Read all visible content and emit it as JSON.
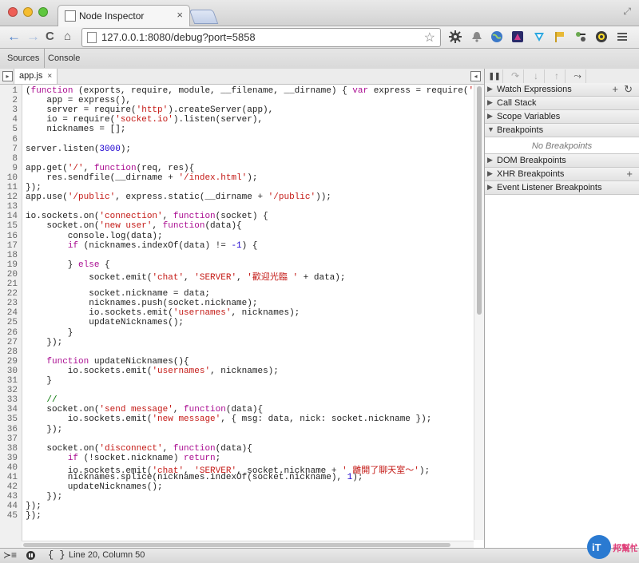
{
  "browser": {
    "tab_title": "Node Inspector",
    "tab_close": "×",
    "url": "127.0.0.1:8080/debug?port=5858",
    "nav": {
      "back": "←",
      "forward": "→",
      "reload": "C",
      "home": "⌂",
      "star": "☆"
    }
  },
  "devtools": {
    "tabs": {
      "sources": "Sources",
      "console": "Console"
    },
    "file_tab": "app.js",
    "file_tab_close": "×",
    "code_lines": [
      "(function (exports, require, module, __filename, __dirname) { var express = require('express'),",
      "    app = express(),",
      "    server = require('http').createServer(app),",
      "    io = require('socket.io').listen(server),",
      "    nicknames = [];",
      "",
      "server.listen(3000);",
      "",
      "app.get('/', function(req, res){",
      "    res.sendfile(__dirname + '/index.html');",
      "});",
      "app.use('/public', express.static(__dirname + '/public'));",
      "",
      "io.sockets.on('connection', function(socket) {",
      "    socket.on('new user', function(data){",
      "        console.log(data);",
      "        if (nicknames.indexOf(data) != -1) {",
      "",
      "        } else {",
      "            socket.emit('chat', 'SERVER', '歡迎光臨 ' + data);",
      "",
      "            socket.nickname = data;",
      "            nicknames.push(socket.nickname);",
      "            io.sockets.emit('usernames', nicknames);",
      "            updateNicknames();",
      "        }",
      "    });",
      "",
      "    function updateNicknames(){",
      "        io.sockets.emit('usernames', nicknames);",
      "    }",
      "",
      "    //",
      "    socket.on('send message', function(data){",
      "        io.sockets.emit('new message', { msg: data, nick: socket.nickname });",
      "    });",
      "",
      "    socket.on('disconnect', function(data){",
      "        if (!socket.nickname) return;",
      "        io.sockets.emit('chat', 'SERVER', socket.nickname + ' 離開了聊天室～');",
      "        nicknames.splice(nicknames.indexOf(socket.nickname), 1);",
      "        updateNicknames();",
      "    });",
      "});",
      "});"
    ],
    "sidebar": {
      "panes": [
        {
          "label": "Watch Expressions",
          "expanded": false
        },
        {
          "label": "Call Stack",
          "expanded": false
        },
        {
          "label": "Scope Variables",
          "expanded": false
        },
        {
          "label": "Breakpoints",
          "expanded": true
        },
        {
          "label": "DOM Breakpoints",
          "expanded": false
        },
        {
          "label": "XHR Breakpoints",
          "expanded": false
        },
        {
          "label": "Event Listener Breakpoints",
          "expanded": false
        }
      ],
      "no_breakpoints": "No Breakpoints",
      "add_symbol": "+",
      "refresh_symbol": "↻"
    },
    "debug_toolbar": {
      "pause": "❚❚",
      "step_over": "↷",
      "step_into": "↓",
      "step_out": "↑",
      "deactivate": "⤳"
    },
    "status": {
      "console_toggle": "≻≡",
      "pretty_print": "{ }",
      "cursor": "Line 20, Column 50"
    }
  },
  "colors": {
    "string": "#c41a16",
    "keyword": "#aa0d91",
    "number": "#1c00cf",
    "comment": "#007400"
  }
}
